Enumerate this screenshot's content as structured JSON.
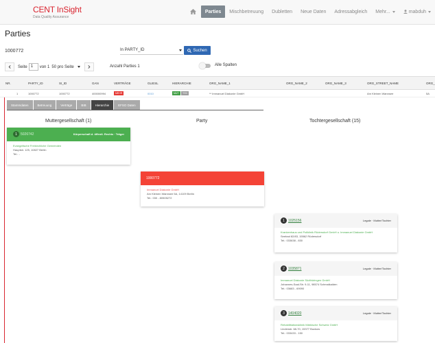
{
  "brand": {
    "title": "CENT InSight",
    "subtitle": "Data Quality Assurance"
  },
  "nav": {
    "items": [
      "Parties",
      "Mischbetreuung",
      "Dubletten",
      "Neue Daten",
      "Adressabgleich",
      "Mehr..."
    ],
    "active_index": 0,
    "user": "mabduh"
  },
  "page": {
    "title": "Parties"
  },
  "search": {
    "value": "1000772",
    "field": "In PARTY_ID",
    "button": "Suchen"
  },
  "pager": {
    "prefix": "Seite",
    "page": "1",
    "of": "von 1",
    "per_page": "50 pro Seite",
    "count_label": "Anzahl Parties 1"
  },
  "toggle": {
    "label": "Alle Spalten",
    "on": false
  },
  "table": {
    "columns": [
      "NR.",
      "PARTY_ID",
      "SI_ID",
      "GAN",
      "VERTRÄGE",
      "GLIESL",
      "HIERARCHIE",
      "ORG_NAME_1",
      "ORG_NAME_2",
      "ORG_NAME_3",
      "ORG_STREET_NAME",
      "ORG_"
    ],
    "row": {
      "nr": "1",
      "party_id": "1000772",
      "si_id": "1000772",
      "gan": "400000994",
      "vertraege": "MEHR",
      "gliesl": "0010",
      "hier_a": "MUT",
      "hier_b": "TÖC",
      "org_name_1": "** Immanuel Diakonie GmbH",
      "org_street": "Am Kleinen Wannsee",
      "org_x": "5A"
    }
  },
  "tabs": [
    "Stammdaten",
    "Betreuung",
    "Verträge",
    "BIB",
    "Hierarchie",
    "EFSO Daten"
  ],
  "tabs_active": 4,
  "hierarchy": {
    "mother": {
      "heading": "Muttergesellschaft (1)",
      "num": "1",
      "id": "5026742",
      "tag": "Körperschaft d. öffentl. Rechts · Träger",
      "name": "Evangelische Freikirchliche Gemeinden",
      "address": "Hauptstr. 125, 10827 Berlin",
      "tel": "Tel.: -"
    },
    "party": {
      "heading": "Party",
      "id": "1000772",
      "name": "Immanuel Diakonie GmbH",
      "address": "Am Kleinen Wannsee 5A, 14109 Berlin",
      "tel": "Tel.: 030 - 80505272"
    },
    "children": {
      "heading": "Tochtergesellschaft (15)",
      "items": [
        {
          "num": "1",
          "id": "1025156",
          "tag": "Legale · Mutter/Tochter",
          "name": "Krankenhaus und Poliklinik Rüdersdorf GmbH u. Immanuel Diakonie GmbH",
          "address": "Seebad 82/83, 15562 Rüdersdorf",
          "tel": "Tel.: 033638 - 830"
        },
        {
          "num": "2",
          "id": "1035871",
          "tag": "Legale · Mutter/Tochter",
          "name": "Immanuel Diakonie Südthüringen GmbH",
          "address": "Johannes-Saal-Str. 9-11, 98574 Schmalkalden",
          "tel": "Tel.: 03683 - 69090"
        },
        {
          "num": "3",
          "id": "1404020",
          "tag": "Legale · Mutter/Tochter",
          "name": "Rehabilitationsklinik Märkische Schweiz GmbH",
          "address": "Lindenstr. 68-70, 15377 Buckow",
          "tel": "Tel.: 033433 - 150"
        }
      ]
    }
  },
  "colors": {
    "brand": "#d9232e",
    "nav_active": "#7e8890",
    "button": "#2f68b3",
    "mother_header": "#4caf50",
    "party_header": "#f44336"
  }
}
